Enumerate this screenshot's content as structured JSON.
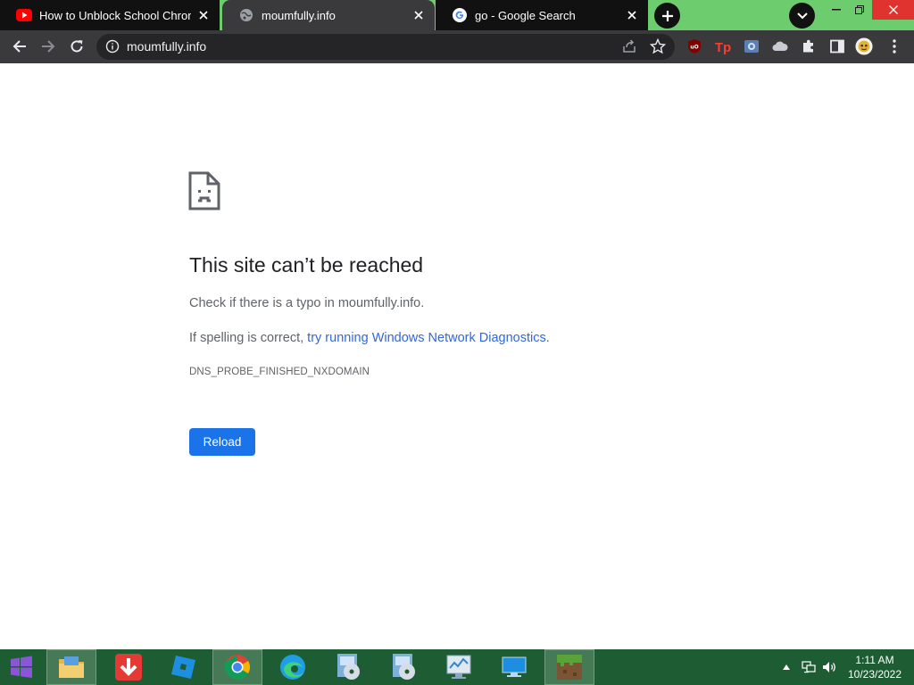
{
  "tabs": [
    {
      "title": "How to Unblock School Chromebook",
      "icon": "youtube-icon"
    },
    {
      "title": "moumfully.info",
      "icon": "globe-icon"
    },
    {
      "title": "go - Google Search",
      "icon": "google-icon"
    }
  ],
  "omnibox": {
    "url": "moumfully.info"
  },
  "error": {
    "heading": "This site can’t be reached",
    "line1": "Check if there is a typo in moumfully.info.",
    "line2_prefix": "If spelling is correct, ",
    "line2_link": "try running Windows Network Diagnostics",
    "line2_suffix": ".",
    "code": "DNS_PROBE_FINISHED_NXDOMAIN",
    "reload_label": "Reload"
  },
  "taskbar": {
    "apps": [
      "start-menu",
      "file-explorer",
      "downloader",
      "roblox",
      "chrome",
      "edge",
      "media-disc",
      "media-disc-2",
      "system-monitor",
      "display",
      "minecraft"
    ],
    "clock_time": "1:11 AM",
    "clock_date": "10/23/2022"
  },
  "colors": {
    "tabstrip_bg": "#6dcc6e",
    "toolbar_bg": "#3a3a3c",
    "accent_blue": "#1a73e8",
    "link_blue": "#3367d6",
    "taskbar_bg": "#1e5d33"
  }
}
